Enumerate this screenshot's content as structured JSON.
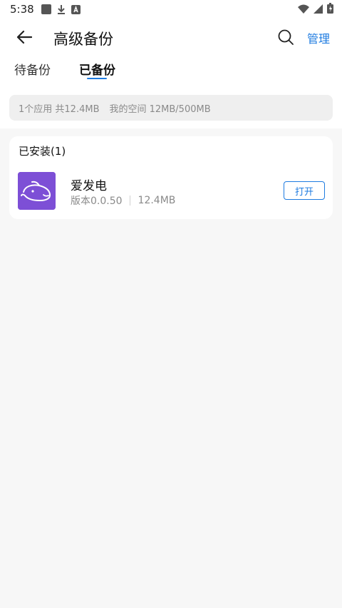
{
  "status_bar": {
    "time": "5:38",
    "icons": [
      "notification-square-icon",
      "download-icon",
      "app-store-icon"
    ],
    "right_icons": [
      "wifi-icon",
      "signal-icon",
      "battery-icon"
    ]
  },
  "header": {
    "title": "高级备份",
    "manage_label": "管理"
  },
  "tabs": [
    {
      "label": "待备份",
      "active": false
    },
    {
      "label": "已备份",
      "active": true
    }
  ],
  "info_bar": {
    "summary": "1个应用 共12.4MB",
    "space": "我的空间 12MB/500MB"
  },
  "installed": {
    "title": "已安装(1)",
    "apps": [
      {
        "name": "爱发电",
        "version": "版本0.0.50",
        "size": "12.4MB",
        "action_label": "打开",
        "icon_color": "#7d4fd6"
      }
    ]
  },
  "colors": {
    "accent": "#1e7be0",
    "background": "#f7f7f7"
  }
}
